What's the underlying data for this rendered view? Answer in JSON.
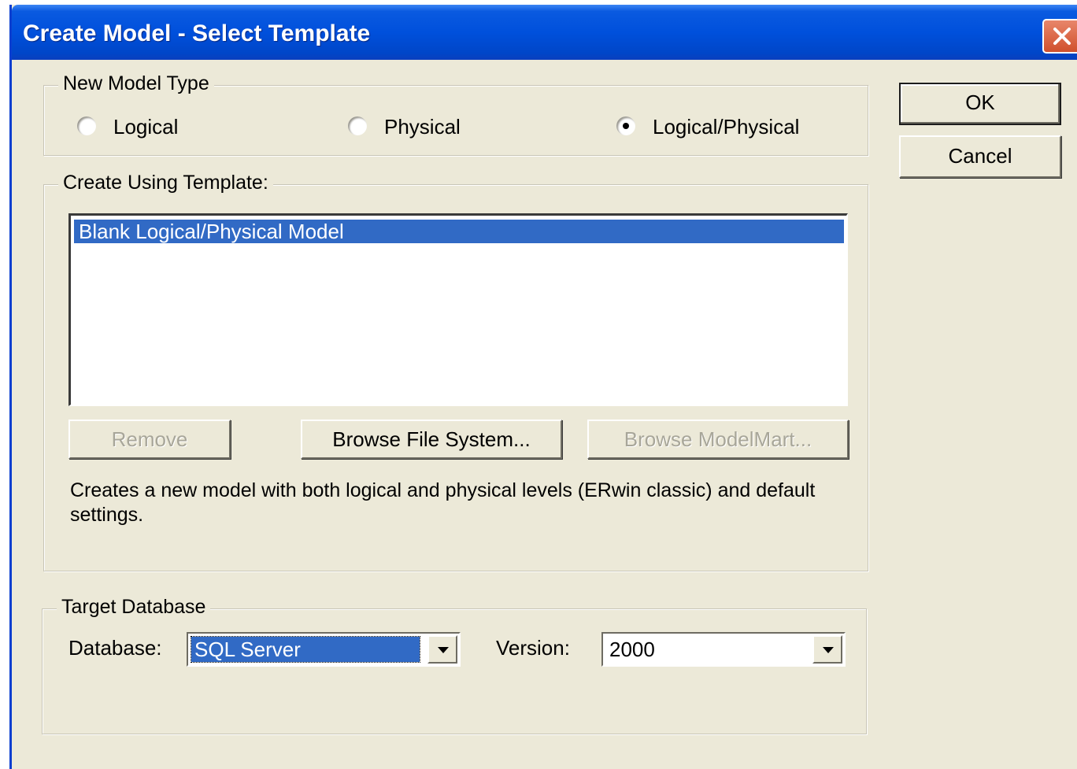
{
  "window": {
    "title": "Create Model - Select Template"
  },
  "model_type": {
    "legend": "New Model Type",
    "options": [
      {
        "label": "Logical",
        "checked": false
      },
      {
        "label": "Physical",
        "checked": false
      },
      {
        "label": "Logical/Physical",
        "checked": true
      }
    ]
  },
  "template": {
    "legend": "Create Using Template:",
    "items": [
      "Blank Logical/Physical Model"
    ],
    "selected_index": 0,
    "buttons": {
      "remove": "Remove",
      "browse_file_system": "Browse File System...",
      "browse_modelmart": "Browse ModelMart..."
    },
    "description": "Creates a new model with both logical and physical levels (ERwin classic) and default settings."
  },
  "target_database": {
    "legend": "Target Database",
    "database_label": "Database:",
    "database_value": "SQL Server",
    "version_label": "Version:",
    "version_value": "2000"
  },
  "actions": {
    "ok": "OK",
    "cancel": "Cancel"
  },
  "icons": {
    "close": "close-icon",
    "radio": "radio-button-icon",
    "dropdown": "chevron-down-icon"
  },
  "colors": {
    "titlebar": "#0050DC",
    "dialog_face": "#ECE9D8",
    "selection": "#316AC5",
    "close_button": "#D0502C"
  }
}
